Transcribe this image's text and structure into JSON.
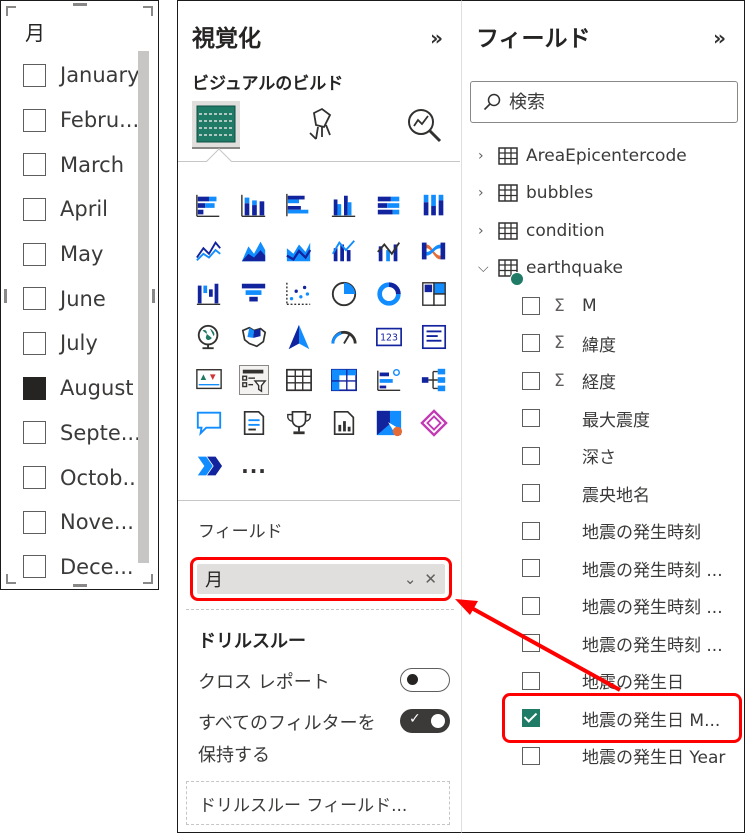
{
  "slicer": {
    "title": "月",
    "items": [
      {
        "label": "January",
        "checked": false
      },
      {
        "label": "Febru...",
        "checked": false
      },
      {
        "label": "March",
        "checked": false
      },
      {
        "label": "April",
        "checked": false
      },
      {
        "label": "May",
        "checked": false
      },
      {
        "label": "June",
        "checked": false
      },
      {
        "label": "July",
        "checked": false
      },
      {
        "label": "August",
        "checked": true
      },
      {
        "label": "Septe...",
        "checked": false
      },
      {
        "label": "Octob...",
        "checked": false
      },
      {
        "label": "Nove...",
        "checked": false
      },
      {
        "label": "Dece...",
        "checked": false
      }
    ]
  },
  "visualizations": {
    "title": "視覚化",
    "expand_icon": "»",
    "build_label": "ビジュアルのビルド",
    "more_label": "...",
    "field_section_label": "フィールド",
    "field_value": "月",
    "drillthrough": {
      "title": "ドリルスルー",
      "cross_report_label": "クロス レポート",
      "cross_report_on": false,
      "keep_filters_label_1": "すべてのフィルターを",
      "keep_filters_label_2": "保持する",
      "keep_filters_on": true,
      "drop_field_placeholder": "ドリルスルー フィールド..."
    }
  },
  "fields": {
    "title": "フィールド",
    "expand_icon": "»",
    "search_placeholder": "検索",
    "tables": [
      {
        "name": "AreaEpicentercode",
        "expanded": false
      },
      {
        "name": "bubbles",
        "expanded": false
      },
      {
        "name": "condition",
        "expanded": false
      },
      {
        "name": "earthquake",
        "expanded": true
      }
    ],
    "earthquake_fields": [
      {
        "name": "M",
        "sigma": true,
        "checked": false
      },
      {
        "name": "緯度",
        "sigma": true,
        "checked": false
      },
      {
        "name": "経度",
        "sigma": true,
        "checked": false
      },
      {
        "name": "最大震度",
        "sigma": false,
        "checked": false
      },
      {
        "name": "深さ",
        "sigma": false,
        "checked": false
      },
      {
        "name": "震央地名",
        "sigma": false,
        "checked": false
      },
      {
        "name": "地震の発生時刻",
        "sigma": false,
        "checked": false
      },
      {
        "name": "地震の発生時刻 ...",
        "sigma": false,
        "checked": false
      },
      {
        "name": "地震の発生時刻 ...",
        "sigma": false,
        "checked": false
      },
      {
        "name": "地震の発生時刻 ...",
        "sigma": false,
        "checked": false
      },
      {
        "name": "地震の発生日",
        "sigma": false,
        "checked": false
      },
      {
        "name": "地震の発生日 M...",
        "sigma": false,
        "checked": true
      },
      {
        "name": "地震の発生日 Year",
        "sigma": false,
        "checked": false
      }
    ],
    "sigma_symbol": "Σ"
  },
  "colors": {
    "accent_teal": "#1f7a66",
    "highlight_red": "#ff0000",
    "viz_blue": "#118dff",
    "viz_dark": "#12239e"
  }
}
